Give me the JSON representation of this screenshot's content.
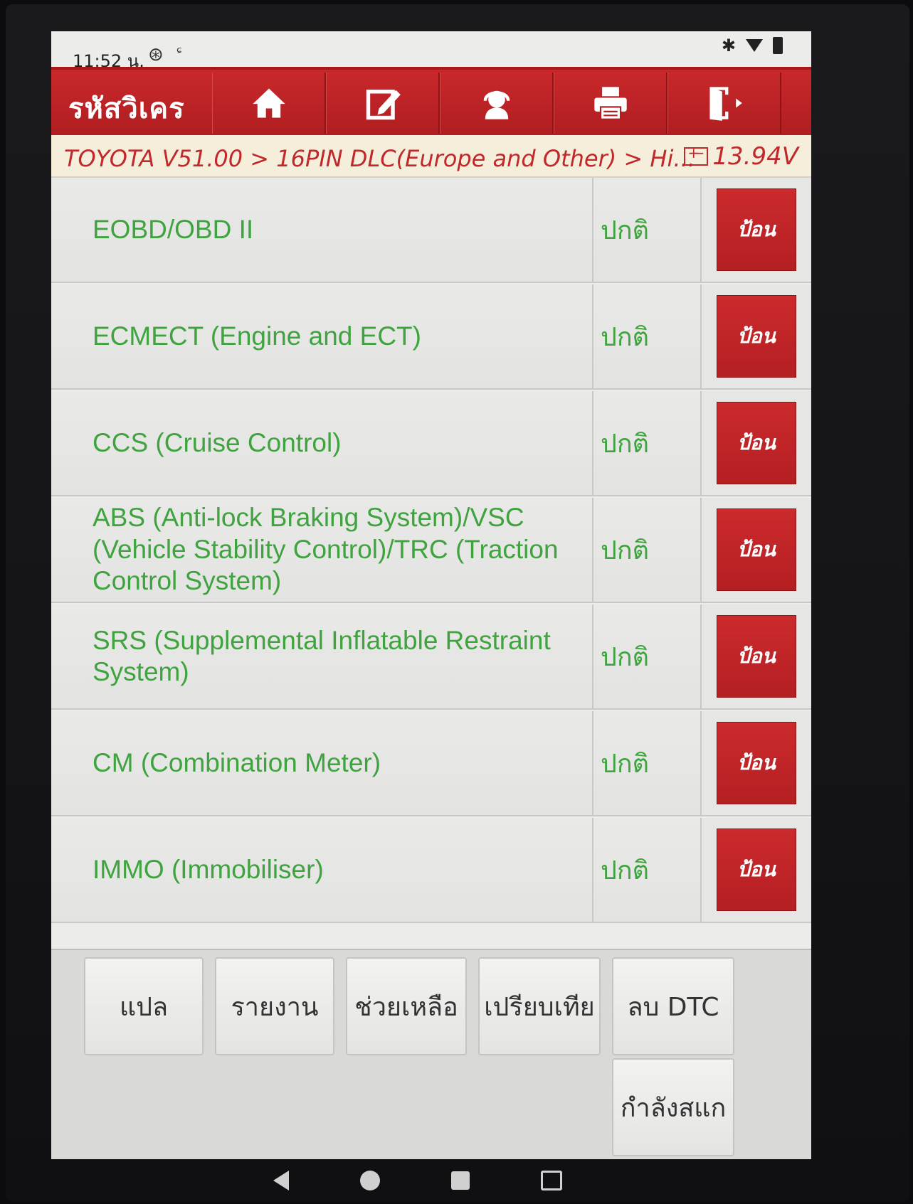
{
  "status_bar": {
    "time": "11:52 น.",
    "icon_1": "⊛",
    "icon_2": "ᶝ"
  },
  "header": {
    "title": "รหัสวิเคร",
    "toolbar": [
      {
        "name": "home-icon"
      },
      {
        "name": "edit-icon"
      },
      {
        "name": "support-icon"
      },
      {
        "name": "print-icon"
      },
      {
        "name": "exit-icon"
      }
    ]
  },
  "breadcrumb": {
    "path": "TOYOTA V51.00 > 16PIN DLC(Europe and Other) > Hi...",
    "voltage": "13.94V"
  },
  "systems": [
    {
      "name": "EOBD/OBD II",
      "status": "ปกติ",
      "action": "ป้อน"
    },
    {
      "name": "ECMECT (Engine and ECT)",
      "status": "ปกติ",
      "action": "ป้อน"
    },
    {
      "name": "CCS (Cruise Control)",
      "status": "ปกติ",
      "action": "ป้อน"
    },
    {
      "name": "ABS (Anti-lock Braking System)/VSC (Vehicle Stability Control)/TRC (Traction Control System)",
      "status": "ปกติ",
      "action": "ป้อน"
    },
    {
      "name": "SRS (Supplemental Inflatable Restraint System)",
      "status": "ปกติ",
      "action": "ป้อน"
    },
    {
      "name": "CM (Combination Meter)",
      "status": "ปกติ",
      "action": "ป้อน"
    },
    {
      "name": "IMMO (Immobiliser)",
      "status": "ปกติ",
      "action": "ป้อน"
    }
  ],
  "actions": {
    "translate": "แปล",
    "report": "รายงาน",
    "help": "ช่วยเหลือ",
    "compare": "เปรียบเทีย",
    "clear_dtc": "ลบ DTC",
    "scanning": "กำลังสแก"
  },
  "colors": {
    "brand_red": "#c0282b",
    "status_green": "#3fa33f",
    "breadcrumb_bg": "#f5eedb"
  }
}
